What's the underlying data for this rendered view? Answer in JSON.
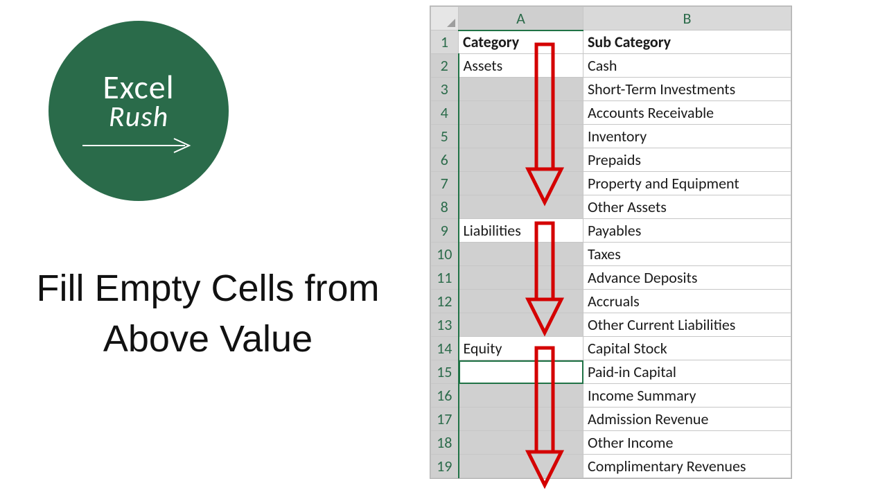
{
  "logo": {
    "line1": "Excel",
    "line2": "Rush"
  },
  "title": "Fill Empty Cells from Above Value",
  "columns": {
    "A": "A",
    "B": "B"
  },
  "headers": {
    "category": "Category",
    "subcategory": "Sub Category"
  },
  "rows": [
    {
      "n": 1,
      "a": "Category",
      "b": "Sub Category",
      "header": true
    },
    {
      "n": 2,
      "a": "Assets",
      "b": "Cash"
    },
    {
      "n": 3,
      "a": "",
      "b": "Short-Term Investments"
    },
    {
      "n": 4,
      "a": "",
      "b": "Accounts Receivable"
    },
    {
      "n": 5,
      "a": "",
      "b": "Inventory"
    },
    {
      "n": 6,
      "a": "",
      "b": "Prepaids"
    },
    {
      "n": 7,
      "a": "",
      "b": "Property and Equipment"
    },
    {
      "n": 8,
      "a": "",
      "b": "Other Assets"
    },
    {
      "n": 9,
      "a": "Liabilities",
      "b": "Payables"
    },
    {
      "n": 10,
      "a": "",
      "b": "Taxes"
    },
    {
      "n": 11,
      "a": "",
      "b": "Advance Deposits"
    },
    {
      "n": 12,
      "a": "",
      "b": "Accruals"
    },
    {
      "n": 13,
      "a": "",
      "b": "Other Current Liabilities"
    },
    {
      "n": 14,
      "a": "Equity",
      "b": "Capital Stock"
    },
    {
      "n": 15,
      "a": "",
      "b": "Paid-in Capital"
    },
    {
      "n": 16,
      "a": "",
      "b": "Income Summary"
    },
    {
      "n": 17,
      "a": "",
      "b": "Admission Revenue"
    },
    {
      "n": 18,
      "a": "",
      "b": "Other Income"
    },
    {
      "n": 19,
      "a": "",
      "b": "Complimentary Revenues"
    }
  ],
  "selection": {
    "col_a_selected": true,
    "selected_empty_rows": [
      3,
      4,
      5,
      6,
      7,
      8,
      10,
      11,
      12,
      13,
      15,
      16,
      17,
      18,
      19
    ],
    "active_row": 15
  }
}
